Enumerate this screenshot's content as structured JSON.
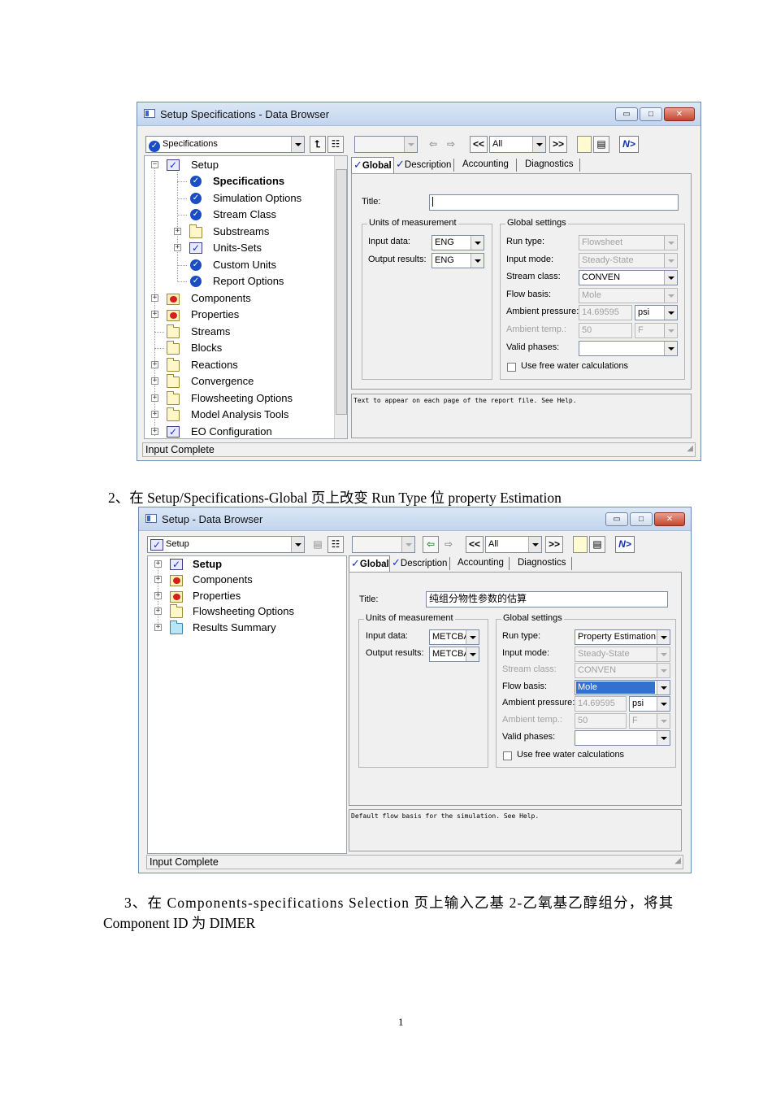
{
  "win1": {
    "title": "Setup Specifications - Data Browser",
    "nav_combo": "Specifications",
    "filter_combo": "All",
    "tree": [
      {
        "label": "Setup",
        "bold": false
      },
      {
        "label": "Specifications",
        "bold": true
      },
      {
        "label": "Simulation Options",
        "bold": false
      },
      {
        "label": "Stream Class",
        "bold": false
      },
      {
        "label": "Substreams",
        "bold": false
      },
      {
        "label": "Units-Sets",
        "bold": false
      },
      {
        "label": "Custom Units",
        "bold": false
      },
      {
        "label": "Report Options",
        "bold": false
      },
      {
        "label": "Components",
        "bold": false
      },
      {
        "label": "Properties",
        "bold": false
      },
      {
        "label": "Streams",
        "bold": false
      },
      {
        "label": "Blocks",
        "bold": false
      },
      {
        "label": "Reactions",
        "bold": false
      },
      {
        "label": "Convergence",
        "bold": false
      },
      {
        "label": "Flowsheeting Options",
        "bold": false
      },
      {
        "label": "Model Analysis Tools",
        "bold": false
      },
      {
        "label": "EO Configuration",
        "bold": false
      }
    ],
    "tabs": [
      "Global",
      "Description",
      "Accounting",
      "Diagnostics"
    ],
    "title_label": "Title:",
    "title_value": "",
    "units_group": "Units of measurement",
    "input_data_label": "Input data:",
    "input_data_value": "ENG",
    "output_results_label": "Output results:",
    "output_results_value": "ENG",
    "global_group": "Global settings",
    "run_type_label": "Run type:",
    "run_type_value": "Flowsheet",
    "input_mode_label": "Input mode:",
    "input_mode_value": "Steady-State",
    "stream_class_label": "Stream class:",
    "stream_class_value": "CONVEN",
    "flow_basis_label": "Flow basis:",
    "flow_basis_value": "Mole",
    "ambient_pressure_label": "Ambient pressure:",
    "ambient_pressure_value": "14.69595",
    "ambient_pressure_unit": "psi",
    "ambient_temp_label": "Ambient temp.:",
    "ambient_temp_value": "50",
    "ambient_temp_unit": "F",
    "valid_phases_label": "Valid phases:",
    "valid_phases_value": "",
    "free_water_label": "Use free water calculations",
    "prompt": "Text to appear on each page of the report file.  See Help.",
    "status": "Input Complete"
  },
  "step2": "2、在 Setup/Specifications-Global 页上改变 Run Type 位 property Estimation",
  "win2": {
    "title": "Setup - Data Browser",
    "nav_combo": "Setup",
    "filter_combo": "All",
    "tree": [
      {
        "label": "Setup",
        "bold": true
      },
      {
        "label": "Components",
        "bold": false
      },
      {
        "label": "Properties",
        "bold": false
      },
      {
        "label": "Flowsheeting Options",
        "bold": false
      },
      {
        "label": "Results Summary",
        "bold": false
      }
    ],
    "tabs": [
      "Global",
      "Description",
      "Accounting",
      "Diagnostics"
    ],
    "title_label": "Title:",
    "title_value": "纯组分物性参数的估算",
    "units_group": "Units of measurement",
    "input_data_label": "Input data:",
    "input_data_value": "METCBA",
    "output_results_label": "Output results:",
    "output_results_value": "METCBA",
    "global_group": "Global settings",
    "run_type_label": "Run type:",
    "run_type_value": "Property Estimation",
    "input_mode_label": "Input mode:",
    "input_mode_value": "Steady-State",
    "stream_class_label": "Stream class:",
    "stream_class_value": "CONVEN",
    "flow_basis_label": "Flow basis:",
    "flow_basis_value": "Mole",
    "ambient_pressure_label": "Ambient pressure:",
    "ambient_pressure_value": "14.69595",
    "ambient_pressure_unit": "psi",
    "ambient_temp_label": "Ambient temp.:",
    "ambient_temp_value": "50",
    "ambient_temp_unit": "F",
    "valid_phases_label": "Valid phases:",
    "valid_phases_value": "",
    "free_water_label": "Use free water calculations",
    "prompt": "Default flow basis for the simulation.  See Help.",
    "status": "Input Complete"
  },
  "step3_line1": "3、在 Components-specifications Selection 页上输入乙基 2-乙氧基乙醇组分，将其",
  "step3_line2": "Component ID 为 DIMER",
  "page_number": "1"
}
